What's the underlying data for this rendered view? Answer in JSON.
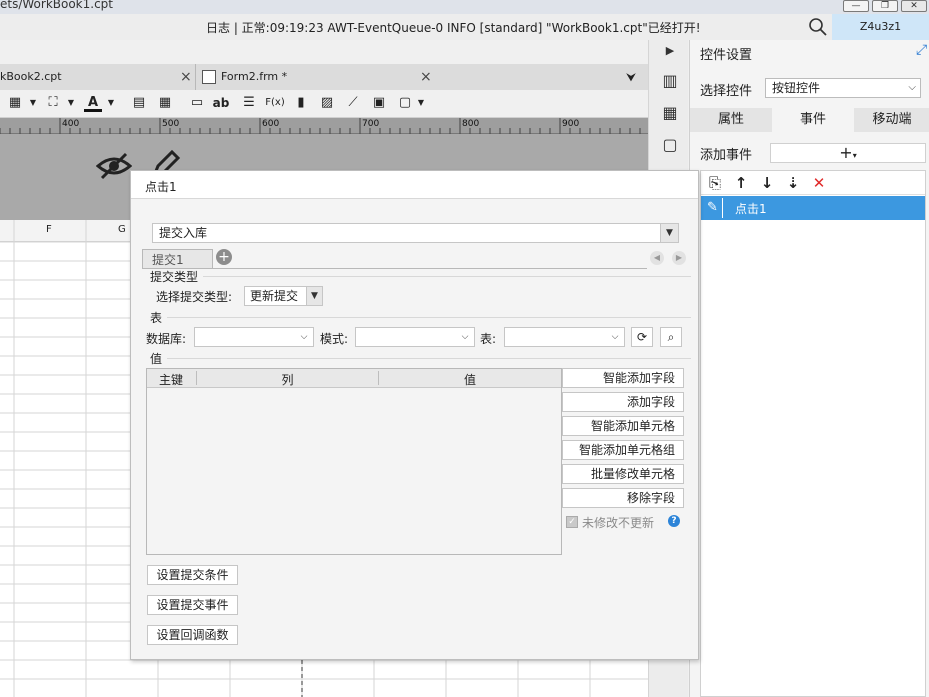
{
  "window": {
    "title_fragment": "ets/WorkBook1.cpt",
    "buttons": [
      "—",
      "❐",
      "✕"
    ]
  },
  "log": {
    "text": "日志 | 正常:09:19:23 AWT-EventQueue-0 INFO [standard] \"WorkBook1.cpt\"已经打开!",
    "user": "Z4u3z1",
    "search_icon": "magnifier"
  },
  "editor": {
    "tabs": [
      {
        "label": "kBook2.cpt",
        "close": "×"
      },
      {
        "label": "Form2.frm *",
        "close": "×"
      }
    ],
    "ruler_labels": [
      "400",
      "500",
      "600",
      "700",
      "800",
      "900"
    ],
    "column_headers": [
      "F",
      "G"
    ],
    "toolbar_icons": [
      "table-icon",
      "fill-icon",
      "font-color-icon",
      "align-icon",
      "grid-icon",
      "line-icon",
      "text-icon",
      "paragraph-icon",
      "formula-icon",
      "chart-icon",
      "image-icon",
      "slash-icon",
      "doc-icon",
      "border-icon"
    ],
    "toolbar_glyphs": {
      "font_color": "A",
      "text": "ab",
      "formula": "F(x)"
    }
  },
  "panel": {
    "title": "控件设置",
    "choose_label": "选择控件",
    "choose_value": "按钮控件",
    "tabs": [
      "属性",
      "事件",
      "移动端"
    ],
    "active_tab": "事件",
    "add_event_label": "添加事件",
    "add_event_glyph": "+",
    "event_tool_glyphs": [
      "⎘",
      "↑",
      "↓",
      "⇣",
      "✕"
    ],
    "events": [
      {
        "label": "点击1"
      }
    ]
  },
  "dialog": {
    "title": "点击1",
    "type_value": "提交入库",
    "subtab": "提交1",
    "section_submit_type": "提交类型",
    "choose_type_label": "选择提交类型:",
    "submit_type_value": "更新提交",
    "section_table": "表",
    "db_label": "数据库:",
    "mode_label": "模式:",
    "table_label": "表:",
    "section_value": "值",
    "columns": [
      "主键",
      "列",
      "值"
    ],
    "right_buttons": [
      "智能添加字段",
      "添加字段",
      "智能添加单元格",
      "智能添加单元格组",
      "批量修改单元格",
      "移除字段"
    ],
    "checkbox_label": "未修改不更新",
    "checkbox_checked": true,
    "help_glyph": "?",
    "bottom_buttons": [
      "设置提交条件",
      "设置提交事件",
      "设置回调函数"
    ]
  },
  "colors": {
    "accent": "#3c98e0",
    "delete_red": "#e02a2a",
    "user_badge": "#cfe6f8"
  }
}
